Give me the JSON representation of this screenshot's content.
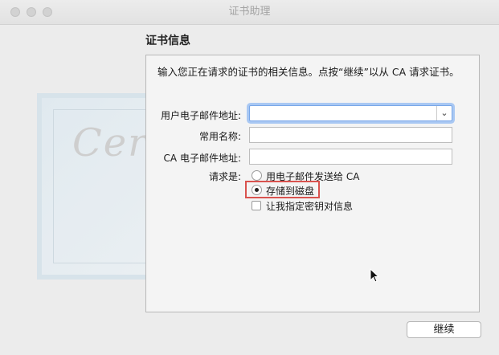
{
  "window": {
    "title": "证书助理"
  },
  "section_title": "证书信息",
  "instructions": "输入您正在请求的证书的相关信息。点按“继续”以从 CA 请求证书。",
  "form": {
    "email_label": "用户电子邮件地址:",
    "email_value": "",
    "common_name_label": "常用名称:",
    "common_name_value": "",
    "ca_email_label": "CA 电子邮件地址:",
    "ca_email_value": "",
    "request_label": "请求是:",
    "options": [
      {
        "label": "用电子邮件发送给 CA",
        "selected": false
      },
      {
        "label": "存储到磁盘",
        "selected": true
      }
    ],
    "specify_key_label": "让我指定密钥对信息",
    "specify_key_checked": false
  },
  "buttons": {
    "continue": "继续"
  },
  "colors": {
    "focus_ring": "#a9c8f3",
    "highlight_box": "#d9534f"
  },
  "artwork": {
    "certificate_word": "Certificate"
  }
}
